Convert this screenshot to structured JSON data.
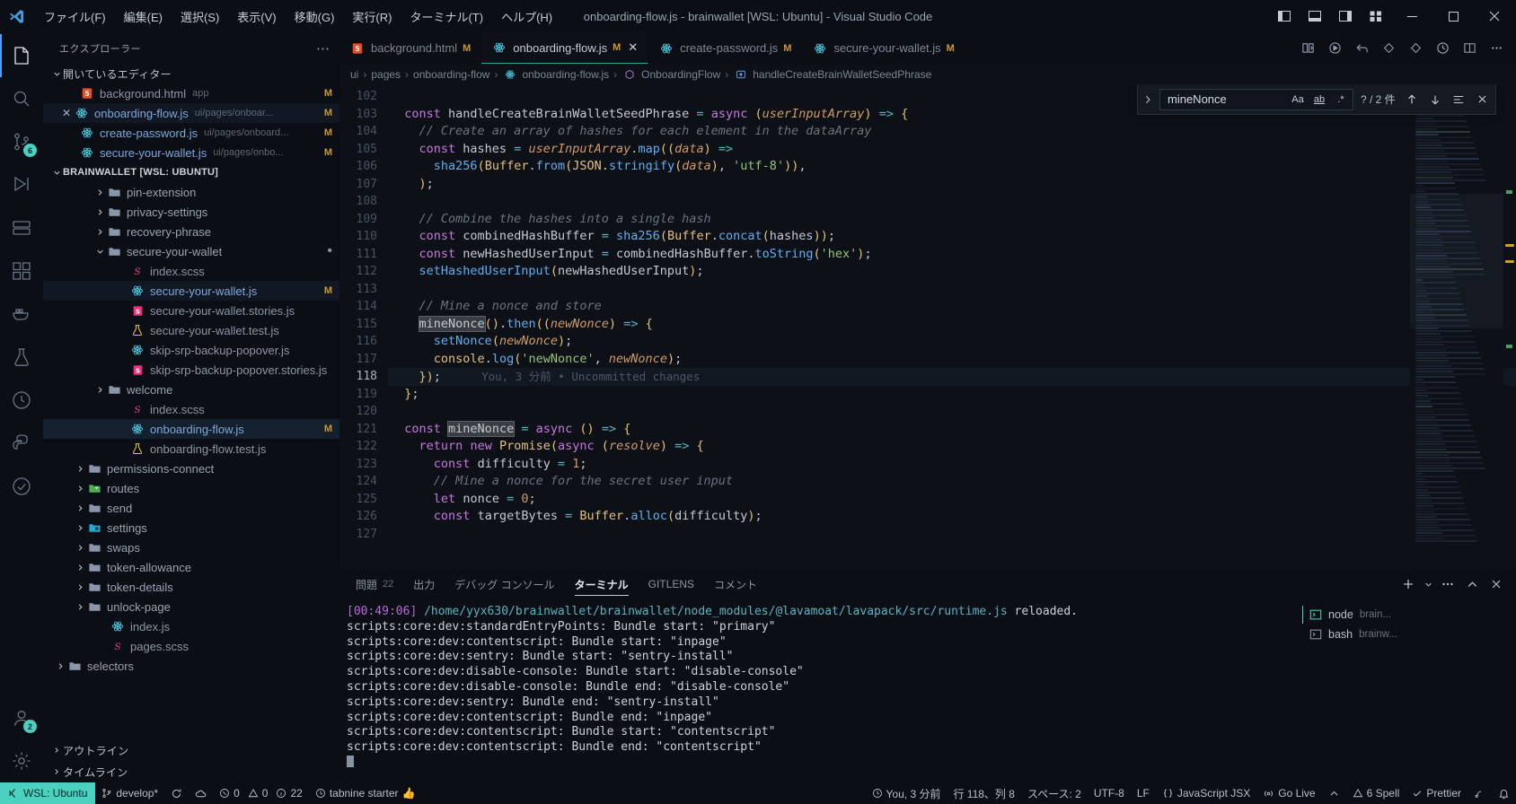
{
  "titlebar": {
    "logo_icon": "vscode-logo-icon",
    "menus": [
      {
        "label": "ファイル(F)",
        "name": "menu-file"
      },
      {
        "label": "編集(E)",
        "name": "menu-edit"
      },
      {
        "label": "選択(S)",
        "name": "menu-selection"
      },
      {
        "label": "表示(V)",
        "name": "menu-view"
      },
      {
        "label": "移動(G)",
        "name": "menu-go"
      },
      {
        "label": "実行(R)",
        "name": "menu-run"
      },
      {
        "label": "ターミナル(T)",
        "name": "menu-terminal"
      },
      {
        "label": "ヘルプ(H)",
        "name": "menu-help"
      }
    ],
    "title": "onboarding-flow.js - brainwallet [WSL: Ubuntu] - Visual Studio Code",
    "layout_buttons": [
      "toggle-primary-sidebar-icon",
      "toggle-panel-icon",
      "toggle-secondary-sidebar-icon",
      "customize-layout-icon"
    ],
    "window_buttons": [
      "minimize-icon",
      "maximize-icon",
      "close-icon"
    ]
  },
  "activitybar": {
    "items": [
      {
        "name": "explorer",
        "icon": "files-icon",
        "active": true,
        "badge": ""
      },
      {
        "name": "search",
        "icon": "search-icon",
        "active": false,
        "badge": ""
      },
      {
        "name": "source-control",
        "icon": "source-control-icon",
        "active": false,
        "badge": "6"
      },
      {
        "name": "run-and-debug",
        "icon": "debug-icon",
        "active": false,
        "badge": ""
      },
      {
        "name": "remote-explorer",
        "icon": "remote-explorer-icon",
        "active": false,
        "badge": ""
      },
      {
        "name": "extensions",
        "icon": "extensions-icon",
        "active": false,
        "badge": ""
      },
      {
        "name": "docker",
        "icon": "docker-icon",
        "active": false,
        "badge": ""
      },
      {
        "name": "testing",
        "icon": "beaker-icon",
        "active": false,
        "badge": ""
      },
      {
        "name": "gitlens",
        "icon": "gitlens-icon",
        "active": false,
        "badge": ""
      },
      {
        "name": "python",
        "icon": "python-icon",
        "active": false,
        "badge": ""
      },
      {
        "name": "todo-tree",
        "icon": "check-circle-icon",
        "active": false,
        "badge": ""
      },
      {
        "name": "accounts",
        "icon": "account-icon",
        "active": false,
        "badge": "2"
      },
      {
        "name": "settings",
        "icon": "gear-icon",
        "active": false,
        "badge": ""
      }
    ]
  },
  "sidebar": {
    "title": "エクスプローラー",
    "more_actions_icon": "ellipsis-icon",
    "open_editors": {
      "label": "開いているエディター",
      "expanded": true,
      "items": [
        {
          "name": "background.html",
          "path": "app",
          "icon": "html-icon",
          "modified": "M",
          "active": false,
          "closable": false
        },
        {
          "name": "onboarding-flow.js",
          "path": "ui/pages/onboar...",
          "icon": "react-icon",
          "modified": "M",
          "active": true,
          "closable": true
        },
        {
          "name": "create-password.js",
          "path": "ui/pages/onboard...",
          "icon": "react-icon",
          "modified": "M",
          "active": false,
          "closable": false
        },
        {
          "name": "secure-your-wallet.js",
          "path": "ui/pages/onbo...",
          "icon": "react-icon",
          "modified": "M",
          "active": false,
          "closable": false
        }
      ]
    },
    "workspace": {
      "label": "BRAINWALLET [WSL: UBUNTU]",
      "expanded": true,
      "tree": [
        {
          "label": "pin-extension",
          "type": "folder",
          "depth": 1,
          "expanded": false
        },
        {
          "label": "privacy-settings",
          "type": "folder",
          "depth": 1,
          "expanded": false
        },
        {
          "label": "recovery-phrase",
          "type": "folder",
          "depth": 1,
          "expanded": false
        },
        {
          "label": "secure-your-wallet",
          "type": "folder",
          "depth": 1,
          "expanded": true,
          "dirty_dot": true
        },
        {
          "label": "index.scss",
          "type": "scss",
          "depth": 2
        },
        {
          "label": "secure-your-wallet.js",
          "type": "react",
          "depth": 2,
          "modified": "M",
          "highlight": true
        },
        {
          "label": "secure-your-wallet.stories.js",
          "type": "storybook",
          "depth": 2
        },
        {
          "label": "secure-your-wallet.test.js",
          "type": "test",
          "depth": 2
        },
        {
          "label": "skip-srp-backup-popover.js",
          "type": "react",
          "depth": 2
        },
        {
          "label": "skip-srp-backup-popover.stories.js",
          "type": "storybook",
          "depth": 2
        },
        {
          "label": "welcome",
          "type": "folder",
          "depth": 1,
          "expanded": false
        },
        {
          "label": "index.scss",
          "type": "scss",
          "depth": 2
        },
        {
          "label": "onboarding-flow.js",
          "type": "react",
          "depth": 2,
          "modified": "M",
          "selected": true,
          "highlight": true
        },
        {
          "label": "onboarding-flow.test.js",
          "type": "test",
          "depth": 2
        },
        {
          "label": "permissions-connect",
          "type": "folder",
          "depth": 0,
          "expanded": false
        },
        {
          "label": "routes",
          "type": "folder-routes",
          "depth": 0,
          "expanded": false
        },
        {
          "label": "send",
          "type": "folder",
          "depth": 0,
          "expanded": false
        },
        {
          "label": "settings",
          "type": "folder-settings",
          "depth": 0,
          "expanded": false
        },
        {
          "label": "swaps",
          "type": "folder",
          "depth": 0,
          "expanded": false
        },
        {
          "label": "token-allowance",
          "type": "folder",
          "depth": 0,
          "expanded": false
        },
        {
          "label": "token-details",
          "type": "folder",
          "depth": 0,
          "expanded": false
        },
        {
          "label": "unlock-page",
          "type": "folder",
          "depth": 0,
          "expanded": false
        },
        {
          "label": "index.js",
          "type": "react",
          "depth": 1
        },
        {
          "label": "pages.scss",
          "type": "scss",
          "depth": 1
        },
        {
          "label": "selectors",
          "type": "folder",
          "depth": -1,
          "expanded": false
        }
      ]
    },
    "bottom_sections": [
      {
        "label": "アウトライン",
        "name": "outline-section"
      },
      {
        "label": "タイムライン",
        "name": "timeline-section"
      }
    ]
  },
  "editor": {
    "tabs": [
      {
        "label": "background.html",
        "icon": "html-icon",
        "modified": "M",
        "active": false,
        "closable": false
      },
      {
        "label": "onboarding-flow.js",
        "icon": "react-icon",
        "modified": "M",
        "active": true,
        "closable": true
      },
      {
        "label": "create-password.js",
        "icon": "react-icon",
        "modified": "M",
        "active": false,
        "closable": false
      },
      {
        "label": "secure-your-wallet.js",
        "icon": "react-icon",
        "modified": "M",
        "active": false,
        "closable": false
      }
    ],
    "tab_actions": [
      "split-editor-icon",
      "run-icon",
      "go-back-icon",
      "diamond-icon",
      "diamond-outline-icon",
      "timeline-icon",
      "split-editor-right-icon",
      "more-actions-icon"
    ],
    "breadcrumb": [
      {
        "label": "ui",
        "icon": ""
      },
      {
        "label": "pages",
        "icon": ""
      },
      {
        "label": "onboarding-flow",
        "icon": ""
      },
      {
        "label": "onboarding-flow.js",
        "icon": "react-icon"
      },
      {
        "label": "OnboardingFlow",
        "icon": "symbol-class-icon"
      },
      {
        "label": "handleCreateBrainWalletSeedPhrase",
        "icon": "symbol-method-icon"
      }
    ],
    "find": {
      "toggle_icon": "chevron-right-icon",
      "query": "mineNonce",
      "match_case_label": "Aa",
      "whole_word_label": "ab",
      "regex_label": ".*",
      "count": "? / 2 件",
      "prev_icon": "arrow-up-icon",
      "next_icon": "arrow-down-icon",
      "find-in-selection-icon": "selection-icon",
      "close_icon": "close-icon"
    },
    "first_line_number": 102,
    "current_line": 118,
    "blame_annotation": "You, 3 分前 • Uncommitted changes",
    "lines": [
      {
        "n": 102,
        "text": ""
      },
      {
        "n": 103,
        "text": "  const handleCreateBrainWalletSeedPhrase = async (userInputArray) => {"
      },
      {
        "n": 104,
        "text": "    // Create an array of hashes for each element in the dataArray"
      },
      {
        "n": 105,
        "text": "    const hashes = userInputArray.map((data) =>"
      },
      {
        "n": 106,
        "text": "      sha256(Buffer.from(JSON.stringify(data), 'utf-8')),"
      },
      {
        "n": 107,
        "text": "    );"
      },
      {
        "n": 108,
        "text": ""
      },
      {
        "n": 109,
        "text": "    // Combine the hashes into a single hash"
      },
      {
        "n": 110,
        "text": "    const combinedHashBuffer = sha256(Buffer.concat(hashes));"
      },
      {
        "n": 111,
        "text": "    const newHashedUserInput = combinedHashBuffer.toString('hex');"
      },
      {
        "n": 112,
        "text": "    setHashedUserInput(newHashedUserInput);"
      },
      {
        "n": 113,
        "text": ""
      },
      {
        "n": 114,
        "text": "    // Mine a nonce and store"
      },
      {
        "n": 115,
        "text": "    mineNonce().then((newNonce) => {"
      },
      {
        "n": 116,
        "text": "      setNonce(newNonce);"
      },
      {
        "n": 117,
        "text": "      console.log('newNonce', newNonce);"
      },
      {
        "n": 118,
        "text": "    });"
      },
      {
        "n": 119,
        "text": "  };"
      },
      {
        "n": 120,
        "text": ""
      },
      {
        "n": 121,
        "text": "  const mineNonce = async () => {"
      },
      {
        "n": 122,
        "text": "    return new Promise(async (resolve) => {"
      },
      {
        "n": 123,
        "text": "      const difficulty = 1;"
      },
      {
        "n": 124,
        "text": "      // Mine a nonce for the secret user input"
      },
      {
        "n": 125,
        "text": "      let nonce = 0;"
      },
      {
        "n": 126,
        "text": "      const targetBytes = Buffer.alloc(difficulty);"
      },
      {
        "n": 127,
        "text": ""
      }
    ]
  },
  "panel": {
    "tabs": [
      {
        "label": "問題",
        "count": "22",
        "active": false,
        "name": "tab-problems"
      },
      {
        "label": "出力",
        "count": "",
        "active": false,
        "name": "tab-output"
      },
      {
        "label": "デバッグ コンソール",
        "count": "",
        "active": false,
        "name": "tab-debug-console"
      },
      {
        "label": "ターミナル",
        "count": "",
        "active": true,
        "name": "tab-terminal"
      },
      {
        "label": "GITLENS",
        "count": "",
        "active": false,
        "name": "tab-gitlens"
      },
      {
        "label": "コメント",
        "count": "",
        "active": false,
        "name": "tab-comments"
      }
    ],
    "actions": [
      "new-terminal-icon",
      "terminal-dropdown-icon",
      "more-actions-icon",
      "maximize-panel-icon",
      "close-panel-icon"
    ],
    "terminal_lines": [
      {
        "time": "[00:49:06]",
        "path": "/home/yyx630/brainwallet/brainwallet/node_modules/@lavamoat/lavapack/src/runtime.js",
        "rest": " reloaded."
      },
      {
        "text": "scripts:core:dev:standardEntryPoints: Bundle start: \"primary\""
      },
      {
        "text": "scripts:core:dev:contentscript: Bundle start: \"inpage\""
      },
      {
        "text": "scripts:core:dev:sentry: Bundle start: \"sentry-install\""
      },
      {
        "text": "scripts:core:dev:disable-console: Bundle start: \"disable-console\""
      },
      {
        "text": "scripts:core:dev:disable-console: Bundle end: \"disable-console\""
      },
      {
        "text": "scripts:core:dev:sentry: Bundle end: \"sentry-install\""
      },
      {
        "text": "scripts:core:dev:contentscript: Bundle end: \"inpage\""
      },
      {
        "text": "scripts:core:dev:contentscript: Bundle start: \"contentscript\""
      },
      {
        "text": "scripts:core:dev:contentscript: Bundle end: \"contentscript\""
      }
    ],
    "terminal_list": [
      {
        "name": "node",
        "sub": "brain...",
        "active": true,
        "icon": "terminal-icon"
      },
      {
        "name": "bash",
        "sub": "brainw...",
        "active": false,
        "icon": "terminal-icon"
      }
    ]
  },
  "statusbar": {
    "remote": {
      "label": "WSL: Ubuntu",
      "icon": "remote-icon"
    },
    "left": [
      {
        "label": "develop*",
        "icon": "source-control-icon",
        "name": "branch-indicator"
      },
      {
        "label": "",
        "icon": "sync-icon",
        "name": "sync-button"
      },
      {
        "label": "",
        "icon": "cloud-icon",
        "name": "remote-indicator"
      },
      {
        "label": "0",
        "icon": "error-icon",
        "name": "errors-count"
      },
      {
        "label": "0",
        "icon": "warning-icon",
        "name": "warnings-count"
      },
      {
        "label": "22",
        "icon": "info-icon",
        "name": "info-count"
      },
      {
        "label": "tabnine starter",
        "icon": "tabnine-icon",
        "name": "tabnine-status",
        "emoji": "👍"
      }
    ],
    "right": [
      {
        "label": "You, 3 分前",
        "icon": "gitlens-blame-icon",
        "name": "git-blame-status"
      },
      {
        "label": "行 118、列 8",
        "icon": "",
        "name": "cursor-position"
      },
      {
        "label": "スペース: 2",
        "icon": "",
        "name": "indentation"
      },
      {
        "label": "UTF-8",
        "icon": "",
        "name": "encoding"
      },
      {
        "label": "LF",
        "icon": "",
        "name": "eol"
      },
      {
        "label": "JavaScript JSX",
        "icon": "braces-icon",
        "name": "language-mode"
      },
      {
        "label": "Go Live",
        "icon": "broadcast-icon",
        "name": "go-live"
      },
      {
        "label": "",
        "icon": "chevron-up-icon",
        "name": "misc-indicator"
      },
      {
        "label": "6 Spell",
        "icon": "warning-icon",
        "name": "spell-checker"
      },
      {
        "label": "Prettier",
        "icon": "check-icon",
        "name": "prettier-status"
      },
      {
        "label": "",
        "icon": "feedback-icon",
        "name": "feedback-button"
      },
      {
        "label": "",
        "icon": "bell-icon",
        "name": "notifications-button"
      }
    ]
  }
}
